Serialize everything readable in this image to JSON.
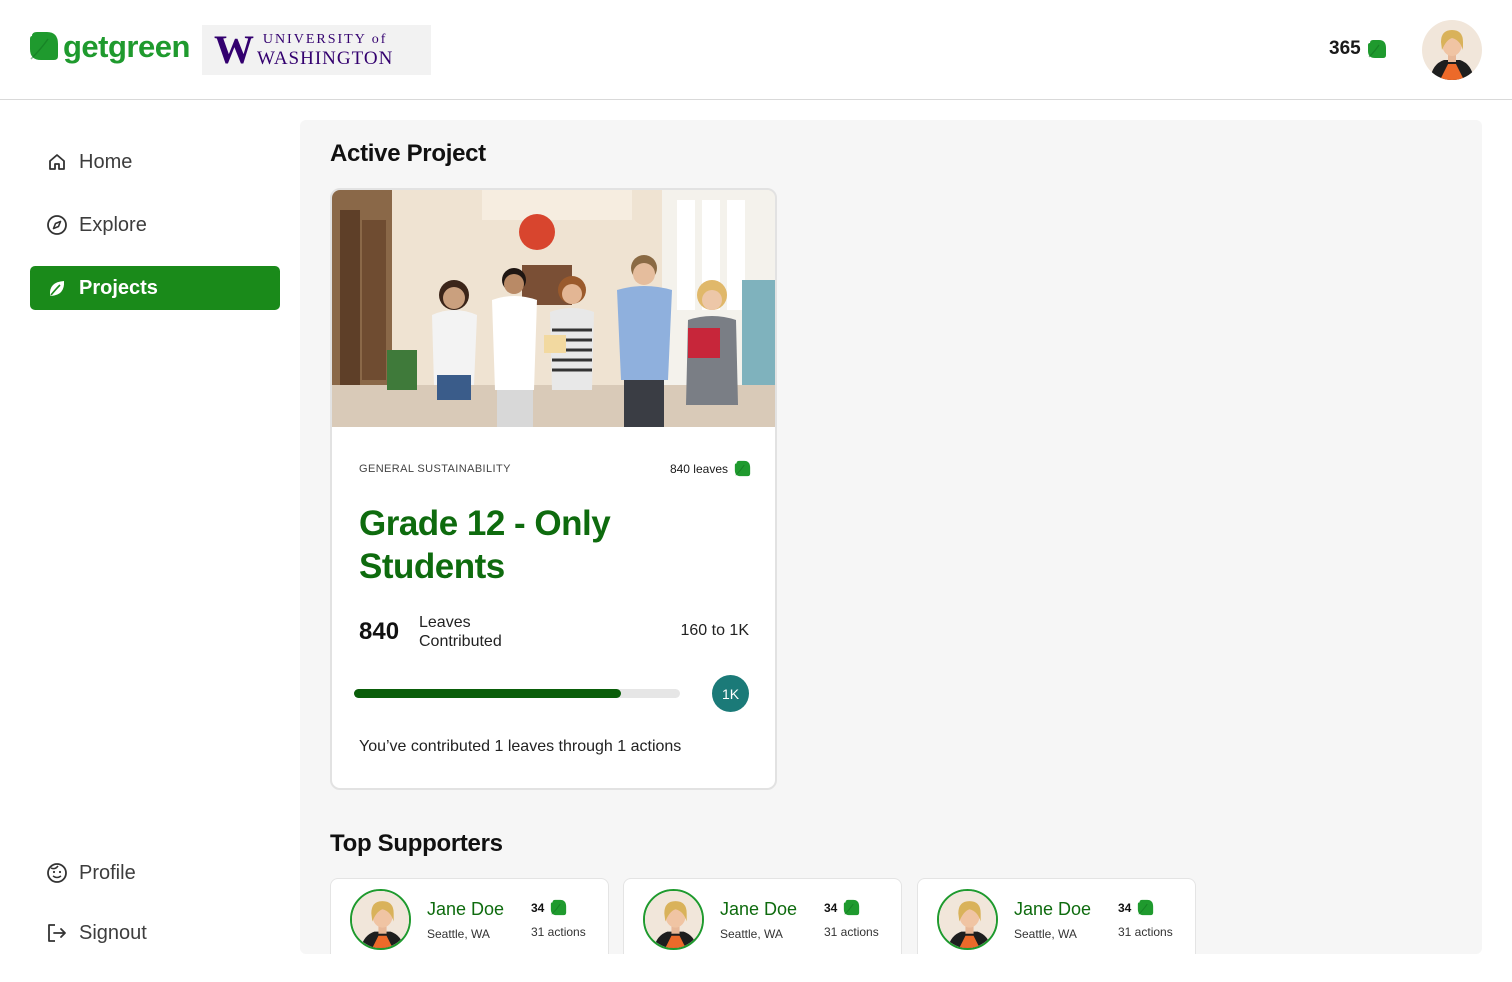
{
  "header": {
    "brand": "getgreen",
    "partner_logo": {
      "mark": "W",
      "line1": "UNIVERSITY of",
      "line2": "WASHINGTON"
    },
    "points": "365",
    "points_icon": "leaf-icon",
    "avatar": "user-avatar"
  },
  "sidebar": {
    "items": [
      {
        "label": "Home",
        "icon": "home-icon",
        "active": false
      },
      {
        "label": "Explore",
        "icon": "compass-icon",
        "active": false
      },
      {
        "label": "Projects",
        "icon": "leaf-icon",
        "active": true
      }
    ],
    "bottom_items": [
      {
        "label": "Profile",
        "icon": "face-icon"
      },
      {
        "label": "Signout",
        "icon": "signout-icon"
      }
    ]
  },
  "main": {
    "active_project_title": "Active Project",
    "project": {
      "category": "GENERAL SUSTAINABILITY",
      "leaves": "840 leaves",
      "title": "Grade 12 - Only Students",
      "contributed_value": "840",
      "contributed_label": "Leaves Contributed",
      "range": "160 to 1K",
      "progress": 0.82,
      "goal_badge": "1K",
      "footer": "You’ve contributed 1 leaves through 1 actions"
    },
    "top_supporters_title": "Top Supporters",
    "supporters": [
      {
        "name": "Jane Doe",
        "location": "Seattle, WA",
        "leaves": "34",
        "actions": "31 actions"
      },
      {
        "name": "Jane Doe",
        "location": "Seattle, WA",
        "leaves": "34",
        "actions": "31 actions"
      },
      {
        "name": "Jane Doe",
        "location": "Seattle, WA",
        "leaves": "34",
        "actions": "31 actions"
      }
    ]
  },
  "colors": {
    "brand_green": "#1f9a2e",
    "active_nav": "#1a8a1a",
    "title_green": "#0e6b0e",
    "progress_fill": "#0a5e0a",
    "goal_badge": "#1b7a78",
    "uw_purple": "#33006f"
  }
}
